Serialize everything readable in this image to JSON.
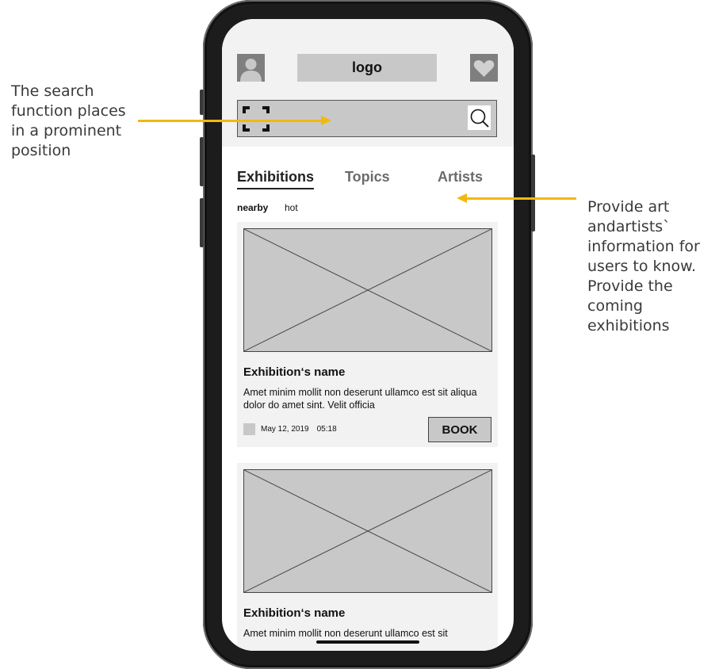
{
  "annotations": {
    "left": [
      "The search",
      "function places",
      "in a prominent",
      "position"
    ],
    "right": [
      "Provide art",
      "andartists`",
      "information for",
      "users to know.",
      "Provide the",
      "coming",
      "exhibitions"
    ],
    "arrow_color": "#f2b90c"
  },
  "header": {
    "logo": "logo",
    "avatar_icon": "user-icon",
    "favorite_icon": "heart-icon"
  },
  "search": {
    "scan_icon": "scan-icon",
    "search_icon": "search-icon"
  },
  "tabs": [
    {
      "label": "Exhibitions",
      "active": true
    },
    {
      "label": "Topics",
      "active": false
    },
    {
      "label": "Artists",
      "active": false
    }
  ],
  "filters": [
    {
      "label": "nearby",
      "active": true
    },
    {
      "label": "hot",
      "active": false
    }
  ],
  "cards": [
    {
      "title": "Exhibition‘s name",
      "description": "Amet minim mollit non deserunt ullamco est sit aliqua dolor do amet sint. Velit officia",
      "date": "May 12, 2019",
      "time": "05:18",
      "button": "BOOK"
    },
    {
      "title": "Exhibition‘s name",
      "description": "Amet minim mollit non deserunt ullamco est sit"
    }
  ]
}
